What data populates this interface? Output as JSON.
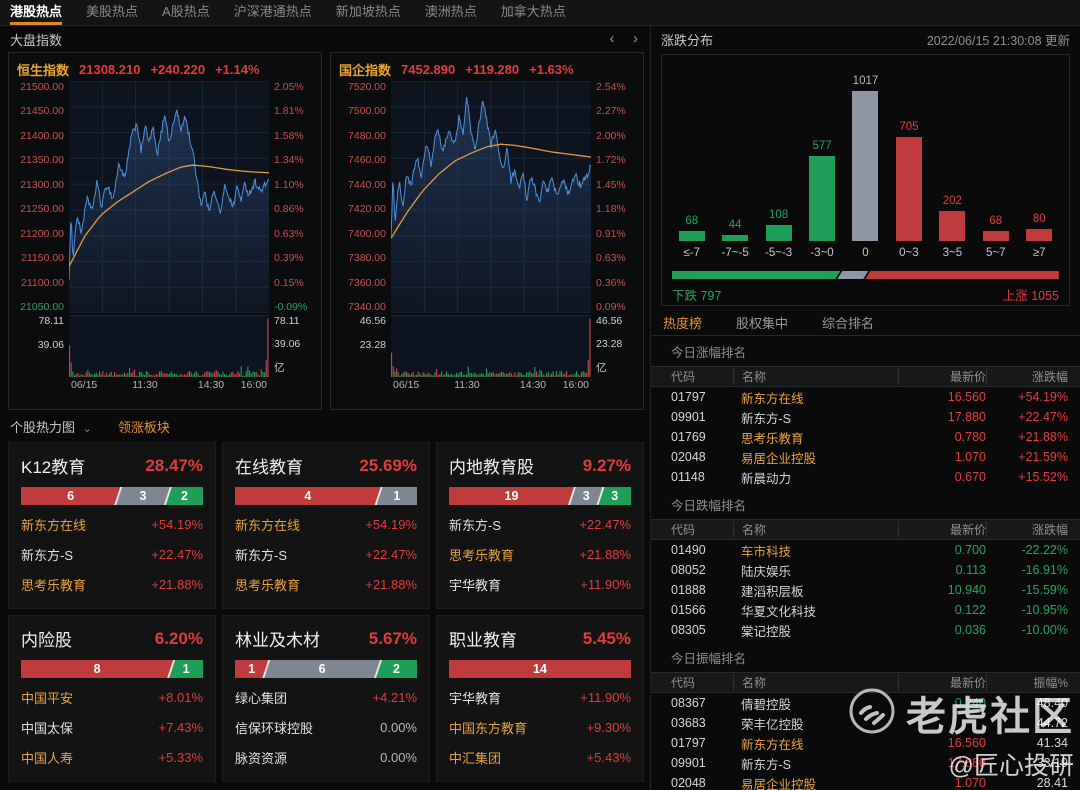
{
  "nav": {
    "tabs": [
      {
        "label": "港股热点",
        "active": true
      },
      {
        "label": "美股热点",
        "active": false
      },
      {
        "label": "A股热点",
        "active": false
      },
      {
        "label": "沪深港通热点",
        "active": false
      },
      {
        "label": "新加坡热点",
        "active": false
      },
      {
        "label": "澳洲热点",
        "active": false
      },
      {
        "label": "加拿大热点",
        "active": false
      }
    ]
  },
  "colors": {
    "up": "#e23b3b",
    "down": "#28a35c",
    "flat": "#8f98a3",
    "accent": "#e6902e",
    "hot_name": "#e8a33d",
    "line": "#4e8fd9",
    "ma": "#e09a40",
    "bar_up": "#c03b3b",
    "bar_down": "#1f9e57",
    "bar_flat": "#8e97a3"
  },
  "left": {
    "section_title": "大盘指数",
    "pager": {
      "prev": "‹",
      "next": "›"
    },
    "heat_header": {
      "dropdown": "个股热力图",
      "chevron": "⌄",
      "active_tab": "领涨板块"
    },
    "tiles": [
      {
        "name": "K12教育",
        "pct": "28.47%",
        "segments": [
          {
            "count": 6,
            "kind": "up"
          },
          {
            "count": 3,
            "kind": "flat"
          },
          {
            "count": 2,
            "kind": "down"
          }
        ],
        "stocks": [
          {
            "name": "新东方在线",
            "hot": true,
            "chg": "+54.19%",
            "dir": "up"
          },
          {
            "name": "新东方-S",
            "hot": false,
            "chg": "+22.47%",
            "dir": "up"
          },
          {
            "name": "思考乐教育",
            "hot": true,
            "chg": "+21.88%",
            "dir": "up"
          }
        ]
      },
      {
        "name": "在线教育",
        "pct": "25.69%",
        "segments": [
          {
            "count": 4,
            "kind": "up"
          },
          {
            "count": 1,
            "kind": "flat"
          }
        ],
        "stocks": [
          {
            "name": "新东方在线",
            "hot": true,
            "chg": "+54.19%",
            "dir": "up"
          },
          {
            "name": "新东方-S",
            "hot": false,
            "chg": "+22.47%",
            "dir": "up"
          },
          {
            "name": "思考乐教育",
            "hot": true,
            "chg": "+21.88%",
            "dir": "up"
          }
        ]
      },
      {
        "name": "内地教育股",
        "pct": "9.27%",
        "segments": [
          {
            "count": 19,
            "kind": "up"
          },
          {
            "count": 3,
            "kind": "flat"
          },
          {
            "count": 3,
            "kind": "down"
          }
        ],
        "stocks": [
          {
            "name": "新东方-S",
            "hot": false,
            "chg": "+22.47%",
            "dir": "up"
          },
          {
            "name": "思考乐教育",
            "hot": true,
            "chg": "+21.88%",
            "dir": "up"
          },
          {
            "name": "宇华教育",
            "hot": false,
            "chg": "+11.90%",
            "dir": "up"
          }
        ]
      },
      {
        "name": "内险股",
        "pct": "6.20%",
        "segments": [
          {
            "count": 8,
            "kind": "up"
          },
          {
            "count": 1,
            "kind": "down"
          }
        ],
        "stocks": [
          {
            "name": "中国平安",
            "hot": true,
            "chg": "+8.01%",
            "dir": "up"
          },
          {
            "name": "中国太保",
            "hot": false,
            "chg": "+7.43%",
            "dir": "up"
          },
          {
            "name": "中国人寿",
            "hot": true,
            "chg": "+5.33%",
            "dir": "up"
          }
        ]
      },
      {
        "name": "林业及木材",
        "pct": "5.67%",
        "segments": [
          {
            "count": 1,
            "kind": "up"
          },
          {
            "count": 6,
            "kind": "flat"
          },
          {
            "count": 2,
            "kind": "down"
          }
        ],
        "stocks": [
          {
            "name": "绿心集团",
            "hot": false,
            "chg": "+4.21%",
            "dir": "up"
          },
          {
            "name": "信保环球控股",
            "hot": false,
            "chg": "0.00%",
            "dir": "flat"
          },
          {
            "name": "脉资资源",
            "hot": false,
            "chg": "0.00%",
            "dir": "flat"
          }
        ]
      },
      {
        "name": "职业教育",
        "pct": "5.45%",
        "segments": [
          {
            "count": 14,
            "kind": "up"
          }
        ],
        "stocks": [
          {
            "name": "宇华教育",
            "hot": false,
            "chg": "+11.90%",
            "dir": "up"
          },
          {
            "name": "中国东方教育",
            "hot": true,
            "chg": "+9.30%",
            "dir": "up"
          },
          {
            "name": "中汇集团",
            "hot": true,
            "chg": "+5.43%",
            "dir": "up"
          }
        ]
      }
    ]
  },
  "right": {
    "dist_title": "涨跌分布",
    "updated": "2022/06/15 21:30:08 更新",
    "ratio": {
      "down_label": "下跌",
      "down_count": "797",
      "up_label": "上涨",
      "up_count": "1055"
    },
    "tabs": [
      {
        "label": "热度榜",
        "active": true
      },
      {
        "label": "股权集中",
        "active": false
      },
      {
        "label": "综合排名",
        "active": false
      }
    ],
    "sections": [
      {
        "title": "今日涨幅排名",
        "cols": [
          "代码",
          "名称",
          "最新价",
          "涨跌幅"
        ],
        "rows": [
          {
            "code": "01797",
            "name": "新东方在线",
            "hot": true,
            "price": "16.560",
            "price_dir": "up",
            "chg": "+54.19%",
            "chg_dir": "up"
          },
          {
            "code": "09901",
            "name": "新东方-S",
            "hot": false,
            "price": "17.880",
            "price_dir": "up",
            "chg": "+22.47%",
            "chg_dir": "up"
          },
          {
            "code": "01769",
            "name": "思考乐教育",
            "hot": true,
            "price": "0.780",
            "price_dir": "up",
            "chg": "+21.88%",
            "chg_dir": "up"
          },
          {
            "code": "02048",
            "name": "易居企业控股",
            "hot": true,
            "price": "1.070",
            "price_dir": "up",
            "chg": "+21.59%",
            "chg_dir": "up"
          },
          {
            "code": "01148",
            "name": "新晨动力",
            "hot": false,
            "price": "0.670",
            "price_dir": "up",
            "chg": "+15.52%",
            "chg_dir": "up"
          }
        ]
      },
      {
        "title": "今日跌幅排名",
        "cols": [
          "代码",
          "名称",
          "最新价",
          "涨跌幅"
        ],
        "rows": [
          {
            "code": "01490",
            "name": "车市科技",
            "hot": true,
            "price": "0.700",
            "price_dir": "down",
            "chg": "-22.22%",
            "chg_dir": "down"
          },
          {
            "code": "08052",
            "name": "陆庆娱乐",
            "hot": false,
            "price": "0.113",
            "price_dir": "down",
            "chg": "-16.91%",
            "chg_dir": "down"
          },
          {
            "code": "01888",
            "name": "建滔积层板",
            "hot": false,
            "price": "10.940",
            "price_dir": "down",
            "chg": "-15.59%",
            "chg_dir": "down"
          },
          {
            "code": "01566",
            "name": "华夏文化科技",
            "hot": false,
            "price": "0.122",
            "price_dir": "down",
            "chg": "-10.95%",
            "chg_dir": "down"
          },
          {
            "code": "08305",
            "name": "棠记控股",
            "hot": false,
            "price": "0.036",
            "price_dir": "down",
            "chg": "-10.00%",
            "chg_dir": "down"
          }
        ]
      },
      {
        "title": "今日振幅排名",
        "cols": [
          "代码",
          "名称",
          "最新价",
          "振幅%"
        ],
        "rows": [
          {
            "code": "08367",
            "name": "倩碧控股",
            "hot": false,
            "price": "0.240",
            "price_dir": "down",
            "chg": "48.40",
            "chg_dir": "amp"
          },
          {
            "code": "03683",
            "name": "荣丰亿控股",
            "hot": false,
            "price": "",
            "price_dir": "up",
            "chg": "44.72",
            "chg_dir": "amp"
          },
          {
            "code": "01797",
            "name": "新东方在线",
            "hot": true,
            "price": "16.560",
            "price_dir": "up",
            "chg": "41.34",
            "chg_dir": "amp"
          },
          {
            "code": "09901",
            "name": "新东方-S",
            "hot": false,
            "price": "17.880",
            "price_dir": "up",
            "chg": "33.19",
            "chg_dir": "amp"
          },
          {
            "code": "02048",
            "name": "易居企业控股",
            "hot": true,
            "price": "1.070",
            "price_dir": "up",
            "chg": "28.41",
            "chg_dir": "amp"
          }
        ]
      }
    ]
  },
  "watermark": {
    "brand": "老虎社区",
    "handle": "@匠心投研"
  },
  "chart_data": [
    {
      "type": "line",
      "title": "恒生指数",
      "price": "21308.210",
      "change": "+240.220",
      "change_pct": "+1.14%",
      "ylim": [
        21050,
        21500
      ],
      "y_left": [
        [
          "21500.00",
          "r"
        ],
        [
          "21450.00",
          "r"
        ],
        [
          "21400.00",
          "r"
        ],
        [
          "21350.00",
          "r"
        ],
        [
          "21300.00",
          "r"
        ],
        [
          "21250.00",
          "r"
        ],
        [
          "21200.00",
          "r"
        ],
        [
          "21150.00",
          "r"
        ],
        [
          "21100.00",
          "r"
        ],
        [
          "21050.00",
          "g"
        ]
      ],
      "y_right": [
        [
          "2.05%",
          "r"
        ],
        [
          "1.81%",
          "r"
        ],
        [
          "1.58%",
          "r"
        ],
        [
          "1.34%",
          "r"
        ],
        [
          "1.10%",
          "r"
        ],
        [
          "0.86%",
          "r"
        ],
        [
          "0.63%",
          "r"
        ],
        [
          "0.39%",
          "r"
        ],
        [
          "0.15%",
          "r"
        ],
        [
          "-0.09%",
          "g"
        ]
      ],
      "x_labels": [
        "06/15",
        "11:30",
        "14:30",
        "16:00"
      ],
      "vol_ticks": [
        "78.11",
        "39.06"
      ],
      "vol_unit": "亿",
      "noise": 7,
      "open_vol_h": 26,
      "close_vol_h": 48,
      "price_keyframes": [
        [
          0,
          21120
        ],
        [
          1,
          21235
        ],
        [
          2,
          21160
        ],
        [
          4,
          21240
        ],
        [
          6,
          21205
        ],
        [
          9,
          21270
        ],
        [
          12,
          21250
        ],
        [
          14,
          21310
        ],
        [
          16,
          21255
        ],
        [
          19,
          21300
        ],
        [
          22,
          21270
        ],
        [
          25,
          21340
        ],
        [
          28,
          21310
        ],
        [
          31,
          21390
        ],
        [
          34,
          21420
        ],
        [
          36,
          21360
        ],
        [
          38,
          21415
        ],
        [
          40,
          21380
        ],
        [
          42,
          21410
        ],
        [
          44,
          21355
        ],
        [
          46,
          21395
        ],
        [
          48,
          21440
        ],
        [
          50,
          21380
        ],
        [
          52,
          21415
        ],
        [
          54,
          21445
        ],
        [
          56,
          21400
        ],
        [
          58,
          21435
        ],
        [
          60,
          21395
        ],
        [
          62,
          21360
        ],
        [
          64,
          21310
        ],
        [
          66,
          21260
        ],
        [
          68,
          21285
        ],
        [
          70,
          21245
        ],
        [
          72,
          21290
        ],
        [
          74,
          21265
        ],
        [
          76,
          21245
        ],
        [
          78,
          21300
        ],
        [
          80,
          21275
        ],
        [
          82,
          21255
        ],
        [
          84,
          21295
        ],
        [
          86,
          21270
        ],
        [
          88,
          21300
        ],
        [
          90,
          21280
        ],
        [
          93,
          21305
        ],
        [
          96,
          21285
        ],
        [
          100,
          21310
        ]
      ],
      "ma_keyframes": [
        [
          0,
          21140
        ],
        [
          8,
          21200
        ],
        [
          16,
          21240
        ],
        [
          24,
          21265
        ],
        [
          32,
          21285
        ],
        [
          40,
          21305
        ],
        [
          48,
          21320
        ],
        [
          56,
          21333
        ],
        [
          62,
          21337
        ],
        [
          70,
          21334
        ],
        [
          80,
          21328
        ],
        [
          90,
          21324
        ],
        [
          100,
          21322
        ]
      ]
    },
    {
      "type": "line",
      "title": "国企指数",
      "price": "7452.890",
      "change": "+119.280",
      "change_pct": "+1.63%",
      "ylim": [
        7340,
        7520
      ],
      "y_left": [
        [
          "7520.00",
          "r"
        ],
        [
          "7500.00",
          "r"
        ],
        [
          "7480.00",
          "r"
        ],
        [
          "7460.00",
          "r"
        ],
        [
          "7440.00",
          "r"
        ],
        [
          "7420.00",
          "r"
        ],
        [
          "7400.00",
          "r"
        ],
        [
          "7380.00",
          "r"
        ],
        [
          "7360.00",
          "r"
        ],
        [
          "7340.00",
          "r"
        ]
      ],
      "y_right": [
        [
          "2.54%",
          "r"
        ],
        [
          "2.27%",
          "r"
        ],
        [
          "2.00%",
          "r"
        ],
        [
          "1.72%",
          "r"
        ],
        [
          "1.45%",
          "r"
        ],
        [
          "1.18%",
          "r"
        ],
        [
          "0.91%",
          "r"
        ],
        [
          "0.63%",
          "r"
        ],
        [
          "0.36%",
          "r"
        ],
        [
          "0.09%",
          "r"
        ]
      ],
      "x_labels": [
        "06/15",
        "11:30",
        "14:30",
        "16:00"
      ],
      "vol_ticks": [
        "46.56",
        "23.28"
      ],
      "vol_unit": "亿",
      "noise": 3,
      "open_vol_h": 20,
      "close_vol_h": 48,
      "price_keyframes": [
        [
          0,
          7400
        ],
        [
          1,
          7447
        ],
        [
          2,
          7408
        ],
        [
          4,
          7442
        ],
        [
          6,
          7425
        ],
        [
          8,
          7448
        ],
        [
          10,
          7438
        ],
        [
          13,
          7462
        ],
        [
          15,
          7445
        ],
        [
          18,
          7472
        ],
        [
          20,
          7455
        ],
        [
          23,
          7483
        ],
        [
          26,
          7465
        ],
        [
          29,
          7482
        ],
        [
          32,
          7470
        ],
        [
          34,
          7492
        ],
        [
          36,
          7478
        ],
        [
          38,
          7508
        ],
        [
          40,
          7482
        ],
        [
          42,
          7465
        ],
        [
          44,
          7488
        ],
        [
          46,
          7505
        ],
        [
          48,
          7488
        ],
        [
          50,
          7470
        ],
        [
          52,
          7483
        ],
        [
          54,
          7463
        ],
        [
          56,
          7450
        ],
        [
          58,
          7468
        ],
        [
          60,
          7442
        ],
        [
          62,
          7452
        ],
        [
          64,
          7435
        ],
        [
          66,
          7448
        ],
        [
          68,
          7428
        ],
        [
          70,
          7445
        ],
        [
          72,
          7437
        ],
        [
          74,
          7425
        ],
        [
          76,
          7442
        ],
        [
          78,
          7432
        ],
        [
          80,
          7445
        ],
        [
          83,
          7430
        ],
        [
          86,
          7442
        ],
        [
          89,
          7432
        ],
        [
          92,
          7447
        ],
        [
          95,
          7438
        ],
        [
          100,
          7453
        ]
      ],
      "ma_keyframes": [
        [
          0,
          7398
        ],
        [
          8,
          7418
        ],
        [
          16,
          7435
        ],
        [
          24,
          7448
        ],
        [
          32,
          7458
        ],
        [
          40,
          7464
        ],
        [
          48,
          7469
        ],
        [
          55,
          7471
        ],
        [
          62,
          7470
        ],
        [
          70,
          7468
        ],
        [
          80,
          7465
        ],
        [
          90,
          7463
        ],
        [
          100,
          7461
        ]
      ]
    },
    {
      "type": "bar",
      "title": "涨跌分布",
      "categories": [
        "≤-7",
        "-7~-5",
        "-5~-3",
        "-3~0",
        "0",
        "0~3",
        "3~5",
        "5~7",
        "≥7"
      ],
      "values": [
        68,
        44,
        108,
        577,
        1017,
        705,
        202,
        68,
        80
      ],
      "kinds": [
        "down",
        "down",
        "down",
        "down",
        "flat",
        "up",
        "up",
        "up",
        "up"
      ],
      "down_total": 797,
      "up_total": 1055
    }
  ]
}
